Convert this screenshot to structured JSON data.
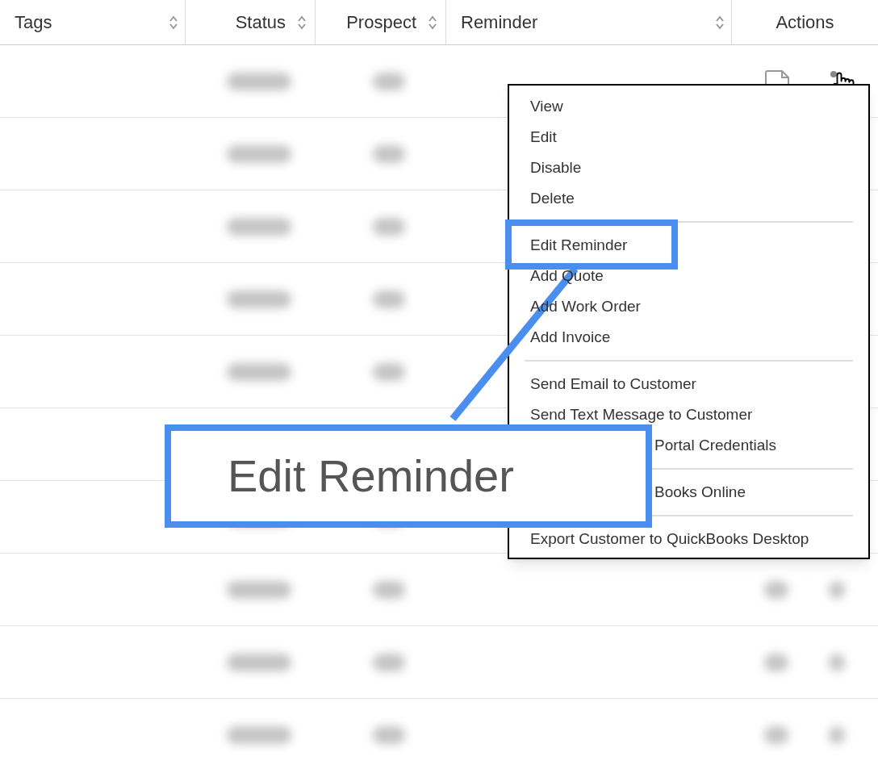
{
  "table": {
    "columns": [
      {
        "label": "Tags",
        "sortable": true
      },
      {
        "label": "Status",
        "sortable": true
      },
      {
        "label": "Prospect",
        "sortable": true
      },
      {
        "label": "Reminder",
        "sortable": true
      },
      {
        "label": "Actions",
        "sortable": false
      }
    ]
  },
  "menu": {
    "groups": [
      [
        {
          "label": "View",
          "kind": "item"
        },
        {
          "label": "Edit",
          "kind": "item"
        },
        {
          "label": "Disable",
          "kind": "item"
        },
        {
          "label": "Delete",
          "kind": "item"
        }
      ],
      [
        {
          "label": "Edit Reminder",
          "kind": "item"
        },
        {
          "label": "Add Quote",
          "kind": "item"
        },
        {
          "label": "Add Work Order",
          "kind": "item"
        },
        {
          "label": "Add Invoice",
          "kind": "item"
        }
      ],
      [
        {
          "label": "Send Email to Customer",
          "kind": "item"
        },
        {
          "label": "Send Text Message to Customer",
          "kind": "item"
        },
        {
          "label": "Portal Credentials",
          "kind": "covered"
        }
      ],
      [
        {
          "label": "Books Online",
          "kind": "covered"
        }
      ],
      [
        {
          "label": "Export Customer to QuickBooks Desktop",
          "kind": "item"
        }
      ]
    ]
  },
  "callout": {
    "text": "Edit Reminder"
  }
}
